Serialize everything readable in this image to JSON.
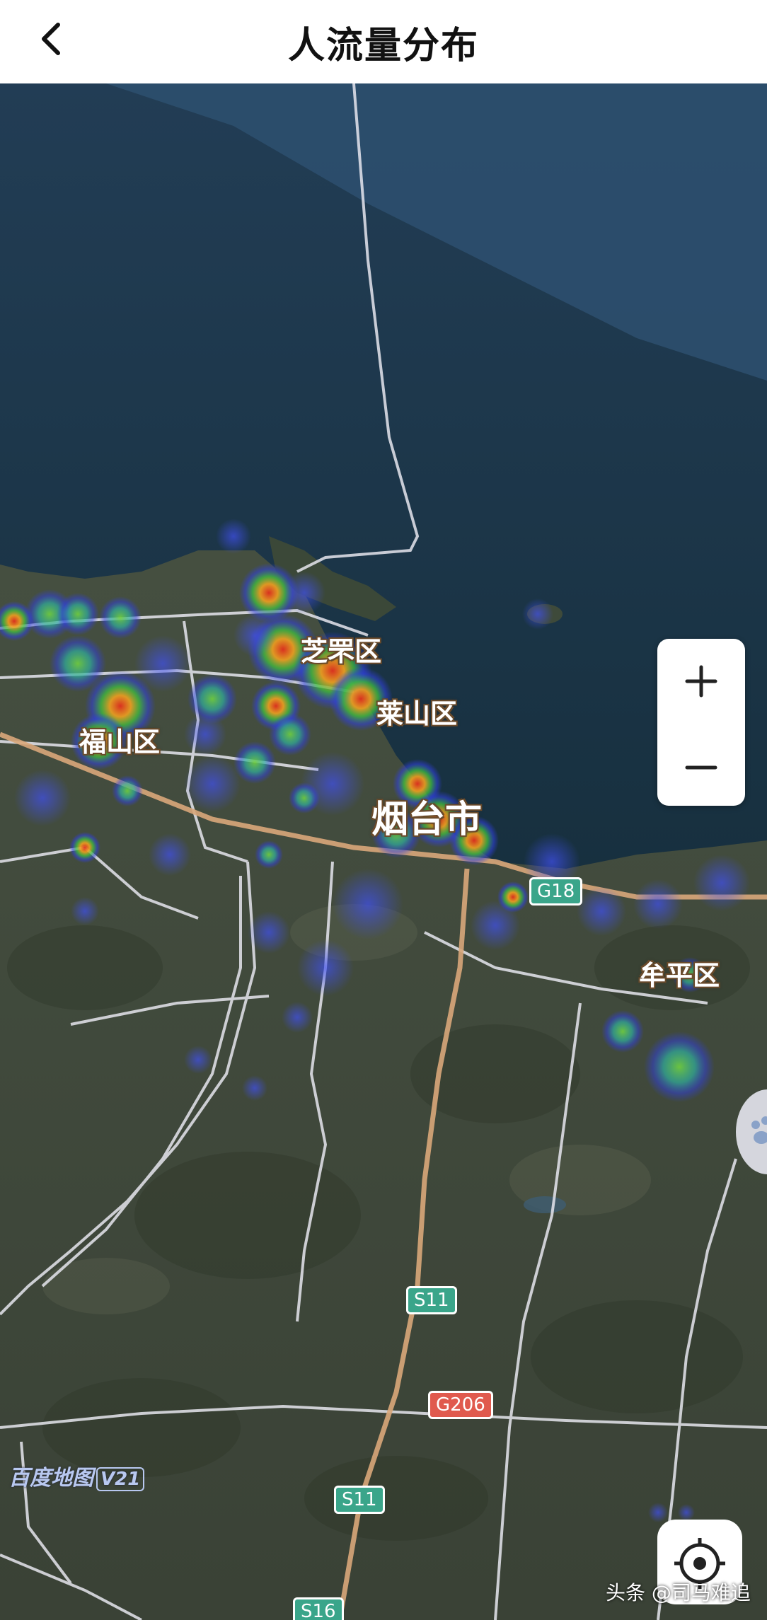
{
  "header": {
    "title": "人流量分布",
    "back_icon": "chevron-left-icon"
  },
  "map": {
    "place_labels": {
      "zhifu": "芝罘区",
      "laishan": "莱山区",
      "fushan": "福山区",
      "yantai": "烟台市",
      "muping": "牟平区"
    },
    "road_shields": {
      "g18": "G18",
      "s11_a": "S11",
      "g206": "G206",
      "s11_b": "S11",
      "s16": "S16"
    },
    "colors": {
      "sea": "#1f3a52",
      "land": "#3f4a3c",
      "expressway": "#d9a77a",
      "road": "#e6e6ee",
      "shield_green": "#3aa58a",
      "shield_red": "#e05a4e"
    }
  },
  "controls": {
    "zoom_in_icon": "plus-icon",
    "zoom_out_icon": "minus-icon",
    "locate_icon": "locate-crosshair-icon"
  },
  "brand": {
    "name": "百度地图",
    "version": "V21"
  },
  "watermark": "头条 @司马难追"
}
